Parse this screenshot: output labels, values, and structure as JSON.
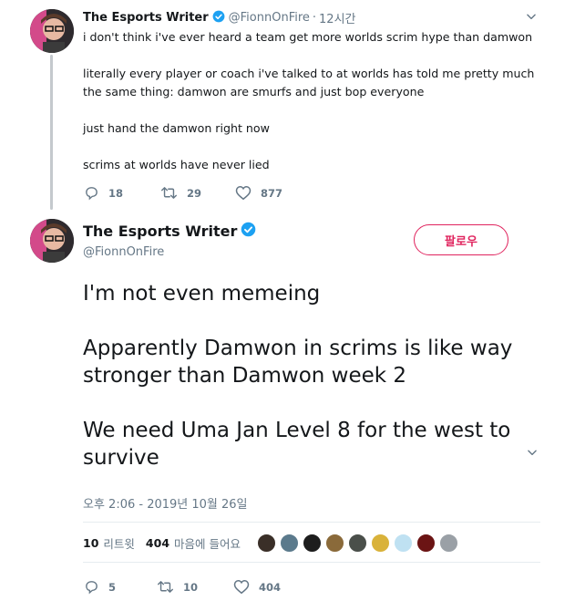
{
  "tweet1": {
    "author_name": "The Esports Writer",
    "handle": "@FionnOnFire",
    "separator": "·",
    "time": "12시간",
    "lines": [
      "i don't think i've ever heard a team get more worlds scrim hype than damwon",
      "literally every player or coach i've talked to at worlds has told me pretty much the same thing: damwon are smurfs and just bop everyone",
      "just hand the damwon right now",
      "scrims at worlds have never lied"
    ],
    "replies": "18",
    "retweets": "29",
    "likes": "877"
  },
  "tweet2": {
    "author_name": "The Esports Writer",
    "handle": "@FionnOnFire",
    "follow_label": "팔로우",
    "lines": [
      "I'm not even memeing",
      "Apparently Damwon in scrims is like way stronger than Damwon week 2",
      "We need Uma Jan Level 8 for the west to survive"
    ],
    "timestamp": "오후 2:06 - 2019년 10월 26일",
    "retweet_count": "10",
    "retweet_label": "리트윗",
    "like_count": "404",
    "like_label": "마음에 들어요",
    "replies": "5",
    "retweets": "10",
    "likes": "404",
    "liker_avatar_colors": [
      "#3a2f28",
      "#5b7a8c",
      "#1d1d1d",
      "#8a6a3a",
      "#4a4f4a",
      "#d9b23a",
      "#bfe1f2",
      "#6b1414",
      "#9aa0a6"
    ]
  },
  "colors": {
    "brand_blue": "#1da1f2",
    "follow_pink": "#e0245e",
    "muted_gray": "#657786"
  },
  "icons": {
    "reply": "reply-icon",
    "retweet": "retweet-icon",
    "like": "heart-icon",
    "verified": "verified-badge-icon",
    "caret": "chevron-down-icon"
  }
}
